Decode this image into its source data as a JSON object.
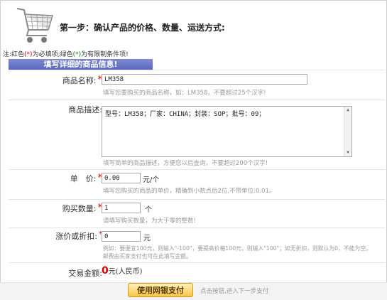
{
  "header": {
    "step_title": "第一步：确认产品的价格、数量、运送方式:"
  },
  "notice": {
    "prefix": "注:红色",
    "red_marker": "(*)",
    "mid": "为必填项;绿色",
    "green_marker": "(*)",
    "suffix": "为有限制条件项!"
  },
  "section": {
    "title": "填写详细的商品信息!"
  },
  "form": {
    "product_name": {
      "label": "商品名称:",
      "required_mark": "*",
      "value": "LM358",
      "hint": "填写您要购买的商品名称，如：LM358，不要超过25个汉字!"
    },
    "product_desc": {
      "label": "商品描述:",
      "value": "型号：LM358；厂家：CHINA；封装：SOP；批号：09；",
      "hint": "填写简单的商品描述，方便您以后查询，不要超过200个汉字!"
    },
    "unit_price": {
      "label": "单　价:",
      "required_mark": "*",
      "value": "0.00",
      "unit": "元/个",
      "hint": "填写您购买的商品的单价，精确到小数点后2位,不带单位:0.01。"
    },
    "quantity": {
      "label": "购买数量:",
      "required_mark": "*",
      "value": "1",
      "unit": "个",
      "hint": "请填写购买数量，为大于零的整数!"
    },
    "adjust": {
      "label": "涨价或折扣:",
      "required_mark": "*",
      "value": "0",
      "unit": "元",
      "hint_line1": "例如：要便宜100元，则输入\"-100\"，要提高价格100元，则输入\"100\"；如无折扣，则默认为0，不能为空。",
      "hint_line2": "邮费由买家支付也可在此填写金额。"
    },
    "total": {
      "label": "交易金额:",
      "value": "0",
      "unit": "元(人民币)"
    }
  },
  "footer": {
    "pay_button": "使用网银支付",
    "next_hint": "点击按钮,进入下一步支付"
  }
}
